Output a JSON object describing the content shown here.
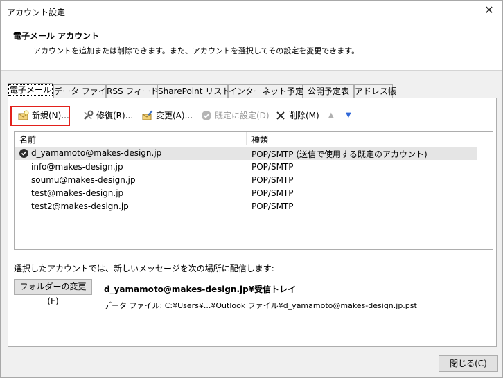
{
  "window": {
    "title": "アカウント設定",
    "close_glyph": "✕"
  },
  "header": {
    "title": "電子メール アカウント",
    "description": "アカウントを追加または削除できます。また、アカウントを選択してその設定を変更できます。"
  },
  "tabs": [
    {
      "label": "電子メール"
    },
    {
      "label": "データ ファイル"
    },
    {
      "label": "RSS フィード"
    },
    {
      "label": "SharePoint リスト"
    },
    {
      "label": "インターネット予定表"
    },
    {
      "label": "公開予定表"
    },
    {
      "label": "アドレス帳"
    }
  ],
  "toolbar": {
    "new_label": "新規(N)...",
    "repair_label": "修復(R)...",
    "change_label": "変更(A)...",
    "set_default_label": "既定に設定(D)",
    "delete_label": "削除(M)",
    "up_glyph": "▲",
    "down_glyph": "▼"
  },
  "list": {
    "col_name": "名前",
    "col_type": "種類",
    "rows": [
      {
        "name": "d_yamamoto@makes-design.jp",
        "type": "POP/SMTP (送信で使用する既定のアカウント)"
      },
      {
        "name": "info@makes-design.jp",
        "type": "POP/SMTP"
      },
      {
        "name": "soumu@makes-design.jp",
        "type": "POP/SMTP"
      },
      {
        "name": "test@makes-design.jp",
        "type": "POP/SMTP"
      },
      {
        "name": "test2@makes-design.jp",
        "type": "POP/SMTP"
      }
    ]
  },
  "delivery": {
    "label": "選択したアカウントでは、新しいメッセージを次の場所に配信します:",
    "folder_button": "フォルダーの変更(F)",
    "folder_path": "d_yamamoto@makes-design.jp¥受信トレイ",
    "data_file": "データ ファイル: C:¥Users¥...¥Outlook ファイル¥d_yamamoto@makes-design.jp.pst"
  },
  "footer": {
    "close_button": "閉じる(C)"
  },
  "colors": {
    "highlight": "#e2211c",
    "selected_row": "#e5e5e5"
  }
}
